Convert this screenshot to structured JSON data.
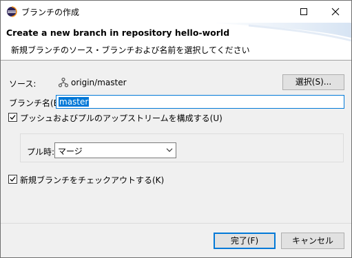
{
  "window": {
    "title": "ブランチの作成"
  },
  "banner": {
    "title": "Create a new branch in repository hello-world",
    "description": "新規ブランチのソース・ブランチおよび名前を選択してください"
  },
  "source": {
    "label": "ソース:",
    "value": "origin/master",
    "select_button": "選択(S)..."
  },
  "branch_name": {
    "label": "ブランチ名(B):",
    "value": "master"
  },
  "configure_push_pull": {
    "label": "プッシュおよびプルのアップストリームを構成する(U)",
    "checked": true
  },
  "pull": {
    "label": "プル時:",
    "selected": "マージ"
  },
  "checkout": {
    "label": "新規ブランチをチェックアウトする(K)",
    "checked": true
  },
  "buttons": {
    "finish": "完了(F)",
    "cancel": "キャンセル"
  },
  "colors": {
    "accent": "#0078d7",
    "background": "#f0f0f0",
    "header": "#ffffff"
  }
}
